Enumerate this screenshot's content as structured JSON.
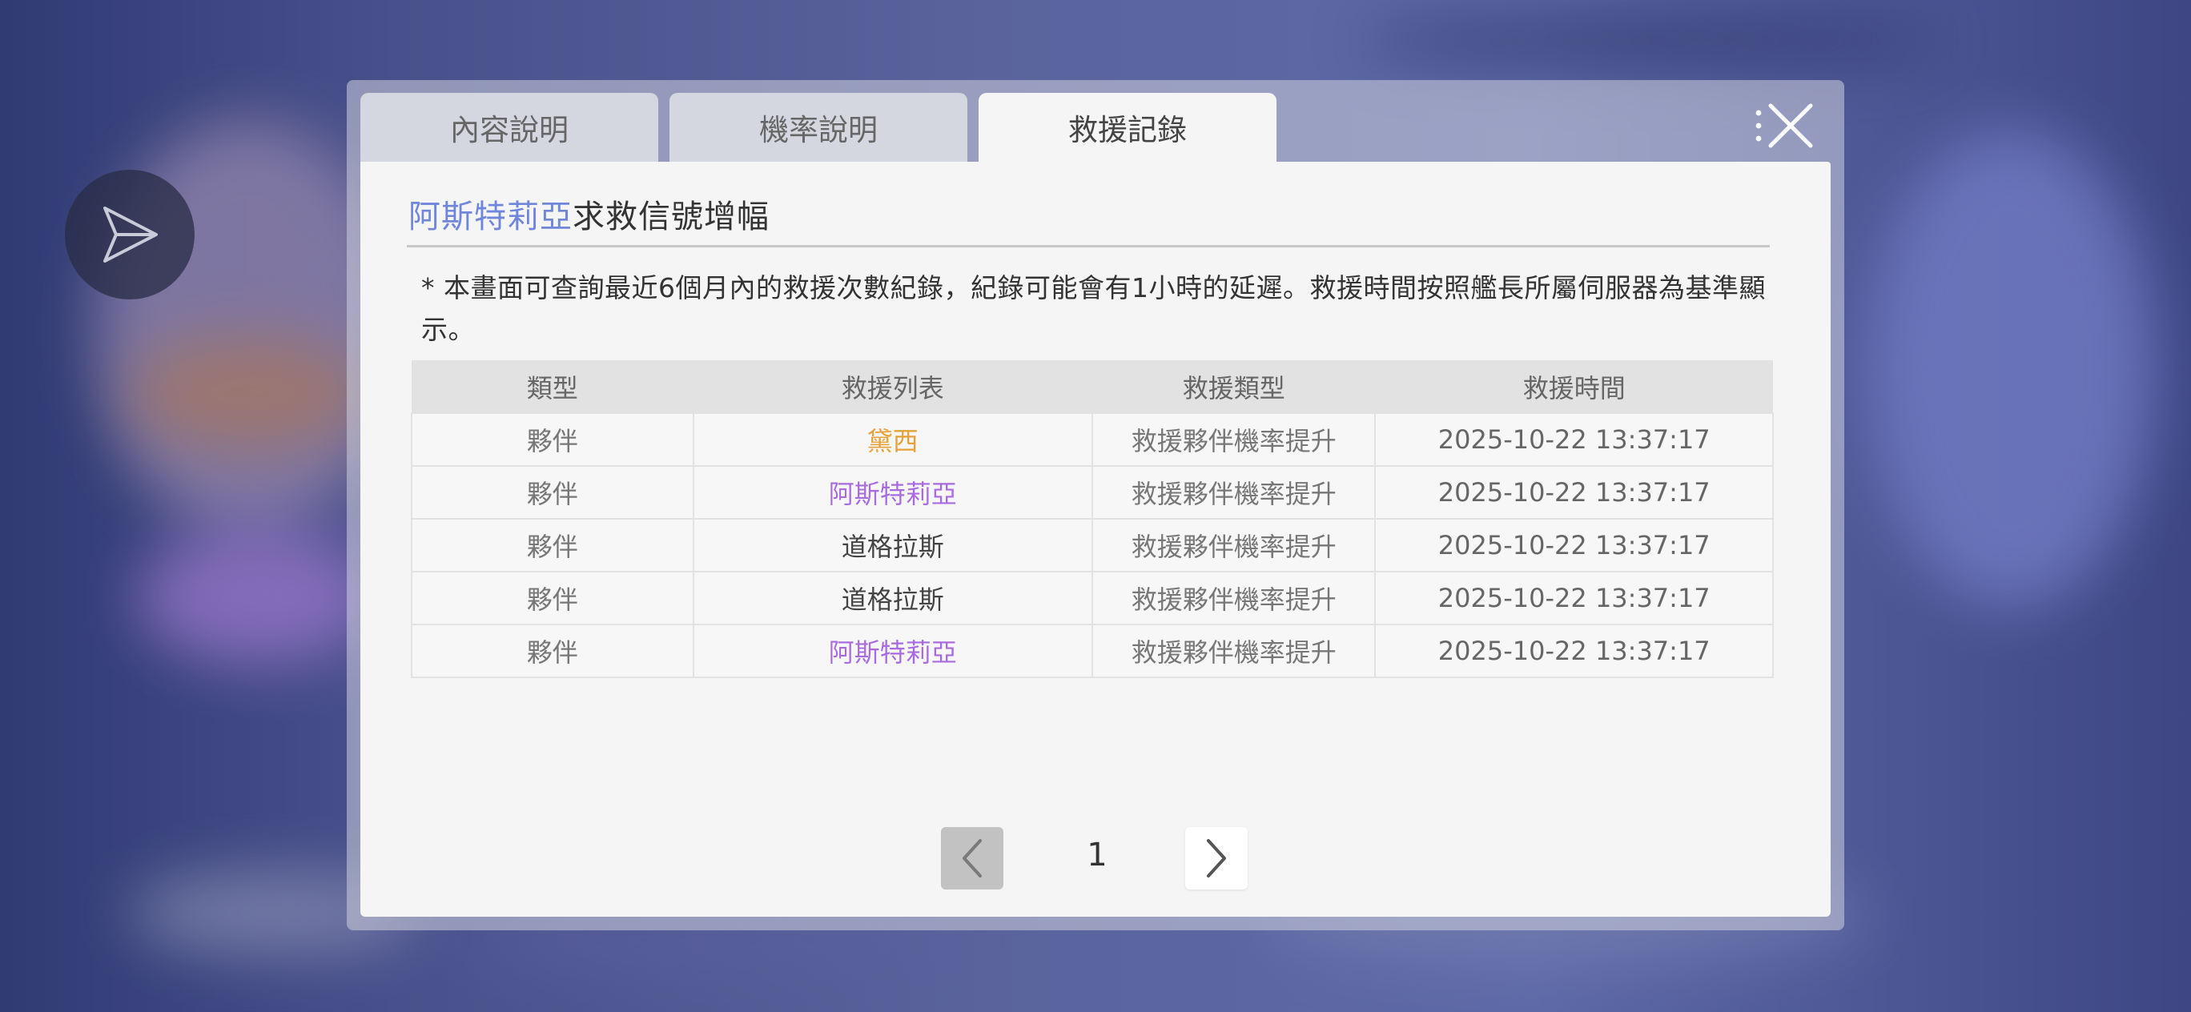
{
  "tabs": [
    {
      "label": "內容說明",
      "active": false
    },
    {
      "label": "機率說明",
      "active": false
    },
    {
      "label": "救援記錄",
      "active": true
    }
  ],
  "title": {
    "hero": "阿斯特莉亞",
    "rest": "求救信號增幅"
  },
  "notice": "* 本畫面可查詢最近6個月內的救援次數紀錄，紀錄可能會有1小時的延遲。救援時間按照艦長所屬伺服器為基準顯示。",
  "table": {
    "headers": [
      "類型",
      "救援列表",
      "救援類型",
      "救援時間"
    ],
    "rows": [
      {
        "type": "夥伴",
        "name": "黛西",
        "name_color": "orange",
        "rescue_type": "救援夥伴機率提升",
        "time": "2025-10-22 13:37:17"
      },
      {
        "type": "夥伴",
        "name": "阿斯特莉亞",
        "name_color": "purple",
        "rescue_type": "救援夥伴機率提升",
        "time": "2025-10-22 13:37:17"
      },
      {
        "type": "夥伴",
        "name": "道格拉斯",
        "name_color": "dark",
        "rescue_type": "救援夥伴機率提升",
        "time": "2025-10-22 13:37:17"
      },
      {
        "type": "夥伴",
        "name": "道格拉斯",
        "name_color": "dark",
        "rescue_type": "救援夥伴機率提升",
        "time": "2025-10-22 13:37:17"
      },
      {
        "type": "夥伴",
        "name": "阿斯特莉亞",
        "name_color": "purple",
        "rescue_type": "救援夥伴機率提升",
        "time": "2025-10-22 13:37:17"
      }
    ]
  },
  "pagination": {
    "current_page": "1"
  },
  "colors": {
    "hero_title": "#6f86db",
    "name_orange": "#e7a23b",
    "name_purple": "#a96be2",
    "name_dark": "#444444"
  },
  "icons": {
    "close": "close-icon",
    "menu": "vertical-dots-icon",
    "prev": "chevron-left-icon",
    "next": "chevron-right-icon",
    "side": "send-arrow-icon"
  }
}
